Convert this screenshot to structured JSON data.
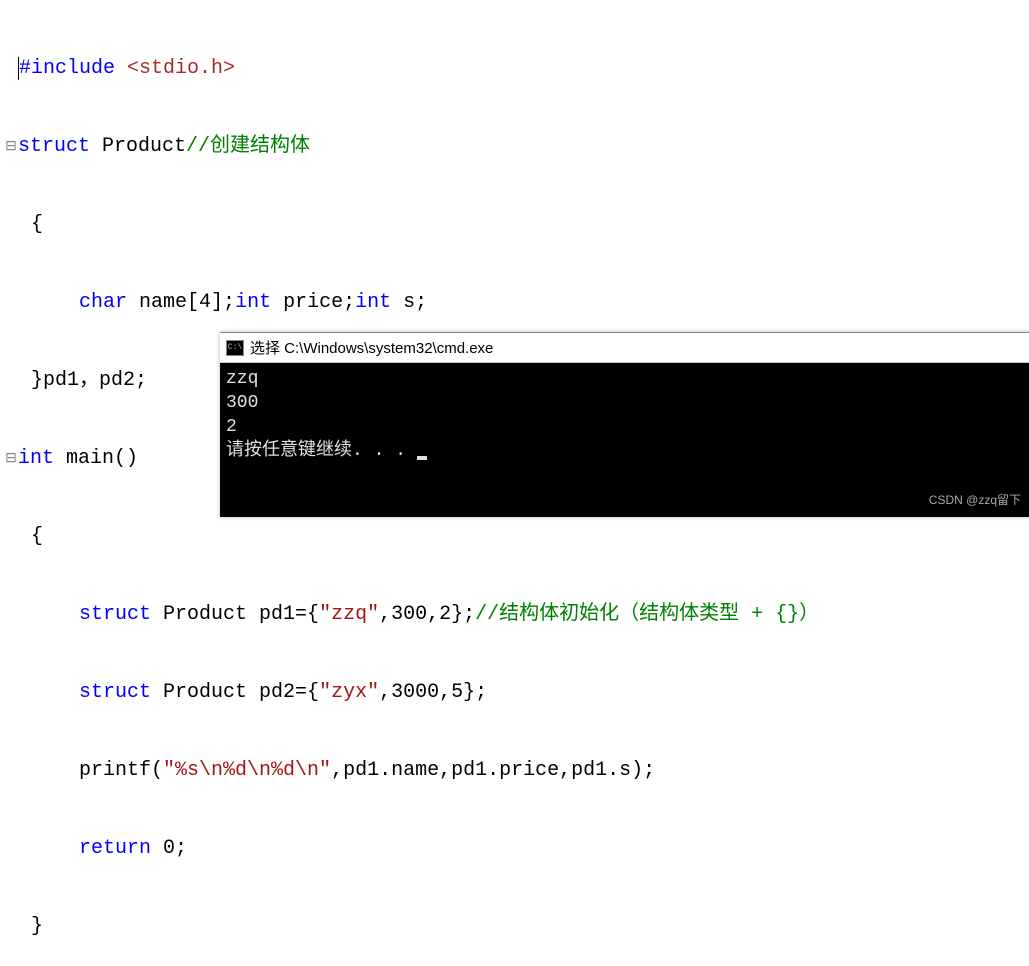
{
  "code": {
    "line1": {
      "include": "#include",
      "header": "<stdio.h>"
    },
    "line2": {
      "struct_kw": "struct",
      "struct_name": " Product",
      "comment": "//创建结构体"
    },
    "line3": {
      "brace": "{"
    },
    "line4": {
      "indent": "    ",
      "char_kw": "char",
      "name_decl": " name[4];",
      "int_kw1": "int",
      "price_decl": " price;",
      "int_kw2": "int",
      "s_decl": " s;"
    },
    "line5": {
      "close": "}pd1，pd2;"
    },
    "line6": {
      "int_kw": "int",
      "main": " main()"
    },
    "line7": {
      "brace": "{"
    },
    "line8": {
      "indent": "    ",
      "struct_kw": "struct",
      "decl": " Product pd1={",
      "str": "\"zzq\"",
      "rest": ",300,2};",
      "comment": "//结构体初始化（结构体类型 + {}）"
    },
    "line9": {
      "indent": "    ",
      "struct_kw": "struct",
      "decl": " Product pd2={",
      "str": "\"zyx\"",
      "rest": ",3000,5};"
    },
    "line10": {
      "indent": "    ",
      "fn": "printf(",
      "str": "\"%s\\n%d\\n%d\\n\"",
      "rest": ",pd1.name,pd1.price,pd1.s);"
    },
    "line11": {
      "indent": "    ",
      "return_kw": "return",
      "rest": " 0;"
    },
    "line12": {
      "brace": "}"
    }
  },
  "console": {
    "title": "选择 C:\\Windows\\system32\\cmd.exe",
    "icon_text": "C:\\",
    "output_line1": "zzq",
    "output_line2": "300",
    "output_line3": "2",
    "output_line4": "请按任意键继续. . . "
  },
  "watermark": "CSDN @zzq留下"
}
